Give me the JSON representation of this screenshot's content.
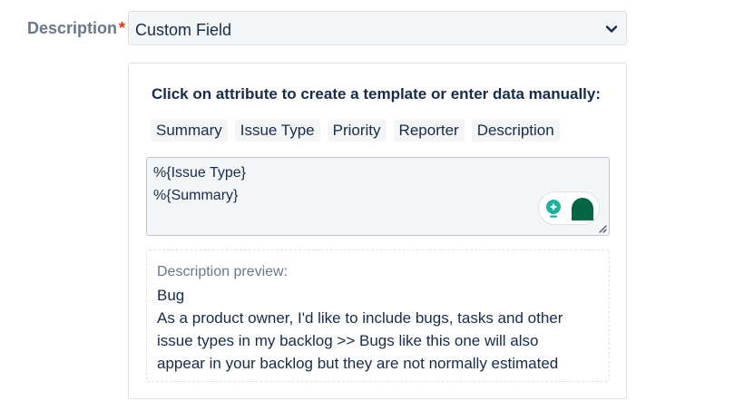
{
  "field": {
    "label": "Description",
    "required_marker": "*",
    "selected_value": "Custom Field"
  },
  "panel": {
    "instruction": "Click on attribute to create a template or enter data manually:",
    "attributes": [
      "Summary",
      "Issue Type",
      "Priority",
      "Reporter",
      "Description"
    ],
    "template_lines": [
      "%{Issue Type}",
      "%{Summary}"
    ],
    "preview": {
      "label": "Description preview:",
      "lines": [
        "Bug",
        "As a product owner, I'd like to include bugs, tasks and other",
        "issue types in my backlog >> Bugs like this one will also",
        "appear in your backlog but they are not normally estimated"
      ]
    }
  },
  "icons": {
    "select_arrow": "chevron-down-icon",
    "assist_bulb": "bulb-icon",
    "assistant": "assistant-icon",
    "resize": "resize-handle-icon"
  },
  "colors": {
    "label": "#6b778c",
    "required": "#de350b",
    "accent_teal": "#1cb39c",
    "accent_dark_green": "#006644",
    "field_background": "#f4f5f7"
  }
}
